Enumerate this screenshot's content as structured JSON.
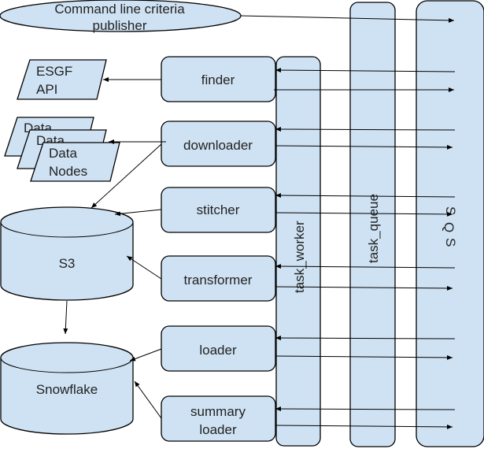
{
  "colors": {
    "fill": "#cfe2f3",
    "stroke": "#000000",
    "text": "#222222"
  },
  "nodes": {
    "publisher": {
      "lines": [
        "Command line criteria",
        "publisher"
      ]
    },
    "esgf_api": {
      "lines": [
        "ESGF",
        "API"
      ]
    },
    "data_nodes": {
      "back_label": "Data",
      "middle_label": "Data",
      "lines": [
        "Data",
        "Nodes"
      ]
    },
    "s3": {
      "label": "S3"
    },
    "snowflake": {
      "label": "Snowflake"
    },
    "finder": {
      "label": "finder"
    },
    "downloader": {
      "label": "downloader"
    },
    "stitcher": {
      "label": "stitcher"
    },
    "transformer": {
      "label": "transformer"
    },
    "loader": {
      "label": "loader"
    },
    "summary_loader": {
      "lines": [
        "summary",
        "loader"
      ]
    },
    "task_worker": {
      "label": "task_worker"
    },
    "task_queue": {
      "label": "task_queue"
    },
    "sqs": {
      "letters": [
        "S",
        "Q",
        "S"
      ]
    }
  },
  "edges": [
    {
      "from": "publisher",
      "to": "sqs"
    },
    {
      "from": "finder",
      "to": "esgf_api"
    },
    {
      "from": "downloader",
      "to": "data_nodes"
    },
    {
      "from": "downloader",
      "to": "s3"
    },
    {
      "from": "stitcher",
      "to": "s3"
    },
    {
      "from": "transformer",
      "to": "s3"
    },
    {
      "from": "s3",
      "to": "snowflake"
    },
    {
      "from": "loader",
      "to": "snowflake"
    },
    {
      "from": "summary_loader",
      "to": "snowflake"
    },
    {
      "from": "sqs",
      "to": "finder"
    },
    {
      "from": "finder",
      "to": "sqs"
    },
    {
      "from": "sqs",
      "to": "downloader"
    },
    {
      "from": "downloader",
      "to": "sqs"
    },
    {
      "from": "sqs",
      "to": "stitcher"
    },
    {
      "from": "stitcher",
      "to": "sqs"
    },
    {
      "from": "sqs",
      "to": "transformer"
    },
    {
      "from": "transformer",
      "to": "sqs"
    },
    {
      "from": "sqs",
      "to": "loader"
    },
    {
      "from": "loader",
      "to": "sqs"
    },
    {
      "from": "sqs",
      "to": "summary_loader"
    },
    {
      "from": "summary_loader",
      "to": "sqs"
    }
  ]
}
